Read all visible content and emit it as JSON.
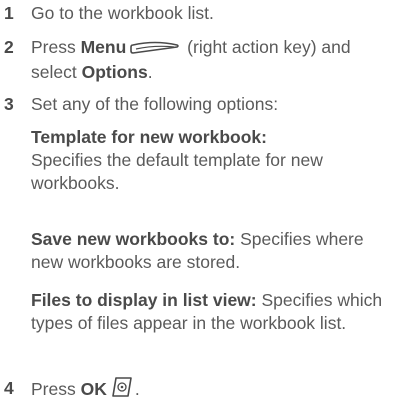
{
  "steps": [
    {
      "num": "1",
      "text": "Go to the workbook list."
    },
    {
      "num": "2",
      "pre": "Press ",
      "bold1": "Menu",
      "icon": "right-action-key-icon",
      "mid": " (right action key) and select ",
      "bold2": "Options",
      "post": "."
    },
    {
      "num": "3",
      "text": "Set any of the following options:"
    },
    {
      "num": "4",
      "pre": "Press ",
      "bold1": "OK",
      "icon": "ok-button-icon",
      "post": "."
    }
  ],
  "options": [
    {
      "label": "Template for new workbook:",
      "desc": "Specifies the default template for new workbooks."
    },
    {
      "label": "Save new workbooks to:",
      "desc": " Specifies where new workbooks are stored."
    },
    {
      "label": "Files to display in list view:",
      "desc": " Specifies which types of files appear in the workbook list."
    }
  ]
}
